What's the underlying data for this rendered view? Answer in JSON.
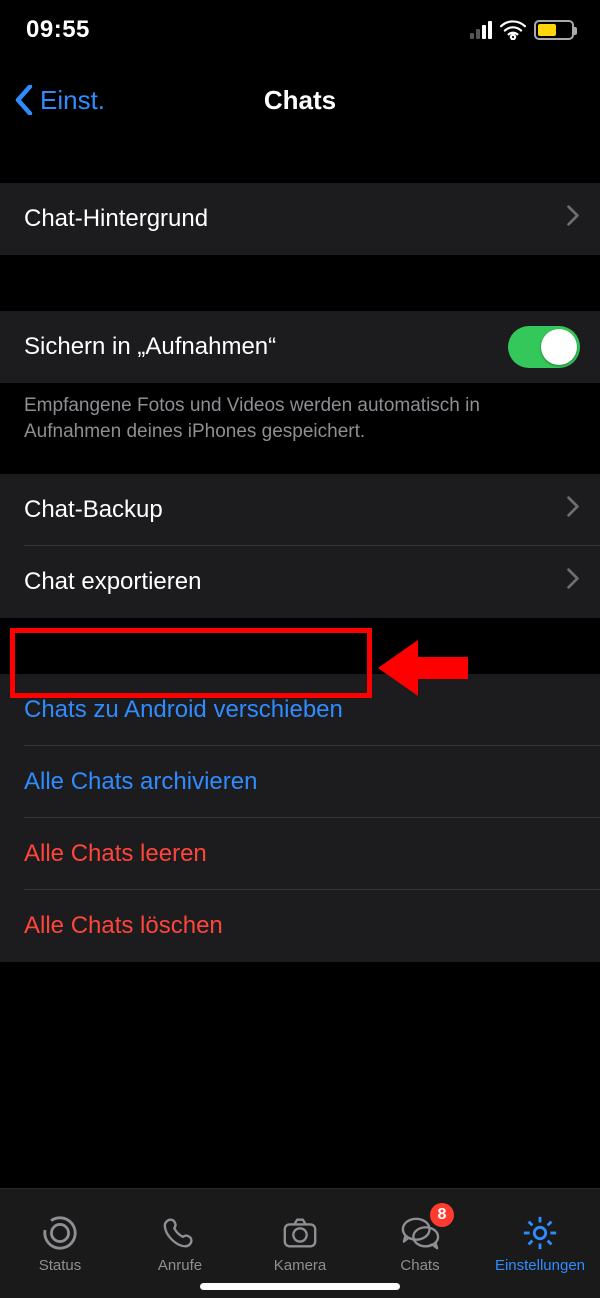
{
  "status": {
    "time": "09:55",
    "battery_pct": 50
  },
  "nav": {
    "back_label": "Einst.",
    "title": "Chats"
  },
  "rows": {
    "wallpaper": "Chat-Hintergrund",
    "save_media": "Sichern in „Aufnahmen“",
    "save_media_note": "Empfangene Fotos und Videos werden automatisch in Aufnahmen deines iPhones gespeichert.",
    "backup": "Chat-Backup",
    "export": "Chat exportieren",
    "move_android": "Chats zu Android verschieben",
    "archive_all": "Alle Chats archivieren",
    "clear_all": "Alle Chats leeren",
    "delete_all": "Alle Chats löschen"
  },
  "tabs": {
    "status": "Status",
    "calls": "Anrufe",
    "camera": "Kamera",
    "chats": "Chats",
    "chats_badge": "8",
    "settings": "Einstellungen"
  }
}
